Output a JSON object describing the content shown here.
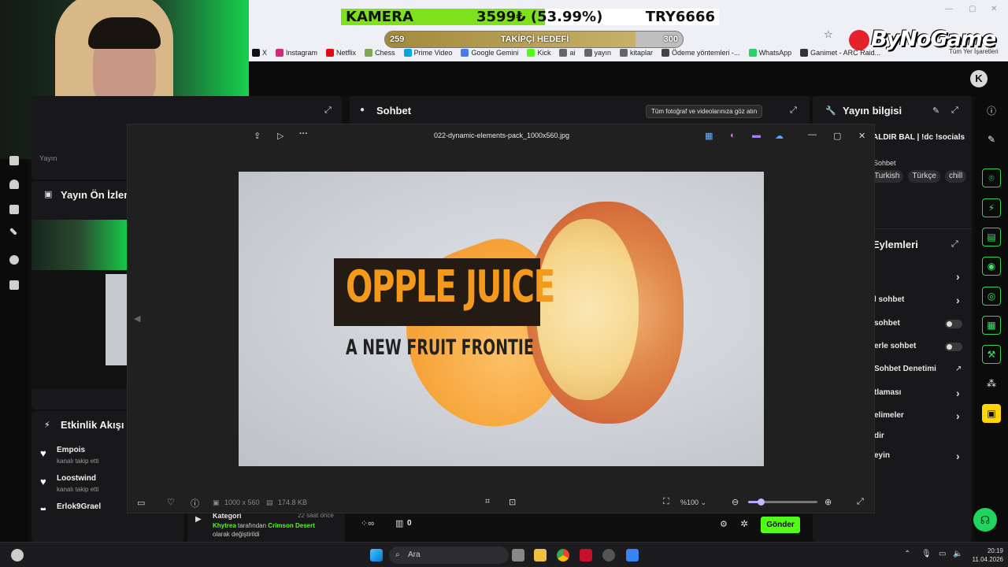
{
  "overlay": {
    "kamera": {
      "label": "KAMERA",
      "amount": "3599₺ (53.99%)",
      "target": "TRY6666",
      "progress": 0.5399
    },
    "followers": {
      "start": "259",
      "label": "TAKİPÇİ HEDEFİ",
      "end": "300",
      "progress": 0.84
    },
    "logo_text": "ByNoGame"
  },
  "bookmarks": [
    {
      "icon": "x-icon",
      "label": "X"
    },
    {
      "icon": "instagram-icon",
      "label": "Instagram"
    },
    {
      "icon": "netflix-icon",
      "label": "Netflix"
    },
    {
      "icon": "chess-icon",
      "label": "Chess"
    },
    {
      "icon": "prime-video-icon",
      "label": "Prime Video"
    },
    {
      "icon": "gemini-icon",
      "label": "Google Gemini"
    },
    {
      "icon": "kick-icon",
      "label": "Kick"
    },
    {
      "icon": "folder-icon",
      "label": "ai"
    },
    {
      "icon": "folder-icon",
      "label": "yayın"
    },
    {
      "icon": "folder-icon",
      "label": "kitaplar"
    },
    {
      "icon": "payment-icon",
      "label": "Ödeme yöntemleri -..."
    },
    {
      "icon": "whatsapp-icon",
      "label": "WhatsApp"
    },
    {
      "icon": "ganimet-icon",
      "label": "Ganimet - ARC Raid..."
    }
  ],
  "bookmarks_more": "Tüm Yer İşaretleri",
  "left_panels": {
    "yayin_label": "Yayın",
    "preview_title": "Yayın Ön İzleme",
    "activity_title": "Etkinlik Akışı",
    "events": [
      {
        "name": "Empois",
        "sub": "kanalı takip etti"
      },
      {
        "name": "Loostwind",
        "sub": "kanalı takip etti"
      },
      {
        "name": "Erlok9Grael",
        "sub": "kanalı takip etti"
      }
    ]
  },
  "chat_panel": {
    "title": "Sohbet"
  },
  "category": {
    "title": "Kategori",
    "time": "22 saat önce",
    "user": "Khytrea",
    "middle": "tarafından",
    "game": "Crimson Desert",
    "suffix": "olarak değiştirildi"
  },
  "chat_input": {
    "count": "0",
    "send_label": "Gönder"
  },
  "right_panel": {
    "info_title": "Yayın bilgisi",
    "stream_title": "ALDIR BAL | !dc !socials",
    "category_label": "Sohbet",
    "tags": [
      "Turkish",
      "Türkçe",
      "chill"
    ],
    "actions_title": "Eylemleri",
    "actions": [
      {
        "label": "",
        "type": "chevron"
      },
      {
        "label": "l sohbet",
        "type": "chevron"
      },
      {
        "label": "sohbet",
        "type": "toggle"
      },
      {
        "label": "erle sohbet",
        "type": "toggle"
      },
      {
        "label": "Sohbet Denetimi",
        "type": "external"
      },
      {
        "label": "tlaması",
        "type": "chevron"
      },
      {
        "label": "elimeler",
        "type": "chevron"
      },
      {
        "label": "dir",
        "type": "none"
      },
      {
        "label": "eyin",
        "type": "chevron"
      }
    ]
  },
  "viewer": {
    "filename": "022-dynamic-elements-pack_1000x560.jpg",
    "tooltip": "Tüm fotoğraf ve videolarınıza göz atın",
    "dimensions": "1000 x 560",
    "filesize": "174.8 KB",
    "zoom": "%100",
    "zoom_fraction": 0.18,
    "image_title": "OPPLE JUICE",
    "image_subtitle": "A NEW FRUIT FRONTIE"
  },
  "taskbar": {
    "search_placeholder": "Ara",
    "time": "20:19",
    "date": "11.04.2026"
  }
}
